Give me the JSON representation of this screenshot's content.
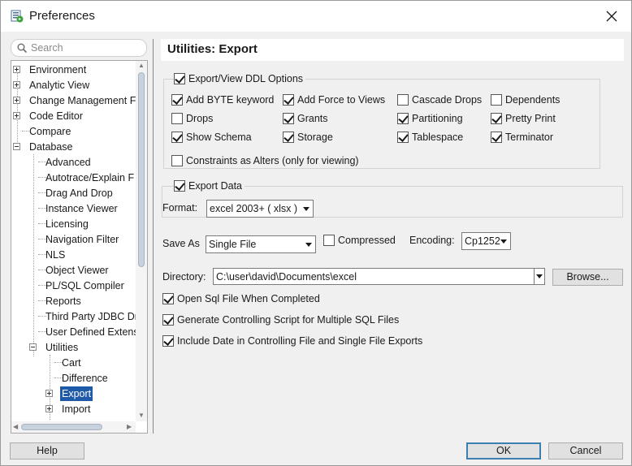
{
  "window": {
    "title": "Preferences",
    "app_icon": "preferences-app-icon",
    "close_icon": "close-icon"
  },
  "search": {
    "placeholder": "Search"
  },
  "tree": {
    "items": [
      {
        "label": "Environment",
        "expander": "plus"
      },
      {
        "label": "Analytic View",
        "expander": "plus"
      },
      {
        "label": "Change Management F",
        "expander": "plus"
      },
      {
        "label": "Code Editor",
        "expander": "plus"
      },
      {
        "label": "Compare",
        "expander": "none"
      },
      {
        "label": "Database",
        "expander": "minus"
      },
      {
        "label": "Advanced"
      },
      {
        "label": "Autotrace/Explain F"
      },
      {
        "label": "Drag And Drop"
      },
      {
        "label": "Instance Viewer"
      },
      {
        "label": "Licensing"
      },
      {
        "label": "Navigation Filter"
      },
      {
        "label": "NLS"
      },
      {
        "label": "Object Viewer"
      },
      {
        "label": "PL/SQL Compiler"
      },
      {
        "label": "Reports"
      },
      {
        "label": "Third Party JDBC Dr"
      },
      {
        "label": "User Defined Extens"
      },
      {
        "label": "Utilities",
        "expander": "minus"
      },
      {
        "label": "Cart"
      },
      {
        "label": "Difference"
      },
      {
        "label": "Export",
        "expander": "plus",
        "selected": true
      },
      {
        "label": "Import",
        "expander": "plus"
      }
    ]
  },
  "content": {
    "title": "Utilities: Export",
    "ddl_group": {
      "label": "Export/View DDL Options",
      "checked": true,
      "options": [
        {
          "label": "Add BYTE keyword",
          "checked": true
        },
        {
          "label": "Add Force to Views",
          "checked": true
        },
        {
          "label": "Cascade Drops",
          "checked": false
        },
        {
          "label": "Dependents",
          "checked": false
        },
        {
          "label": "Drops",
          "checked": false
        },
        {
          "label": "Grants",
          "checked": true
        },
        {
          "label": "Partitioning",
          "checked": true
        },
        {
          "label": "Pretty Print",
          "checked": true
        },
        {
          "label": "Show Schema",
          "checked": true
        },
        {
          "label": "Storage",
          "checked": true
        },
        {
          "label": "Tablespace",
          "checked": true
        },
        {
          "label": "Terminator",
          "checked": true
        },
        {
          "label": "Constraints as Alters (only for viewing)",
          "checked": false
        }
      ]
    },
    "data_group": {
      "label": "Export Data",
      "checked": true,
      "format_label": "Format:",
      "format_value": "excel 2003+ ( xlsx )"
    },
    "save_as_label": "Save As",
    "save_as_value": "Single File",
    "compressed_label": "Compressed",
    "compressed_checked": false,
    "encoding_label": "Encoding:",
    "encoding_value": "Cp1252",
    "directory_label": "Directory:",
    "directory_value": "C:\\user\\david\\Documents\\excel",
    "browse_label": "Browse...",
    "options": [
      {
        "label": "Open Sql File When Completed",
        "checked": true
      },
      {
        "label": "Generate Controlling Script for Multiple SQL Files",
        "checked": true
      },
      {
        "label": "Include Date in Controlling File and Single File Exports",
        "checked": true
      }
    ]
  },
  "footer": {
    "help_label": "Help",
    "ok_label": "OK",
    "cancel_label": "Cancel"
  }
}
